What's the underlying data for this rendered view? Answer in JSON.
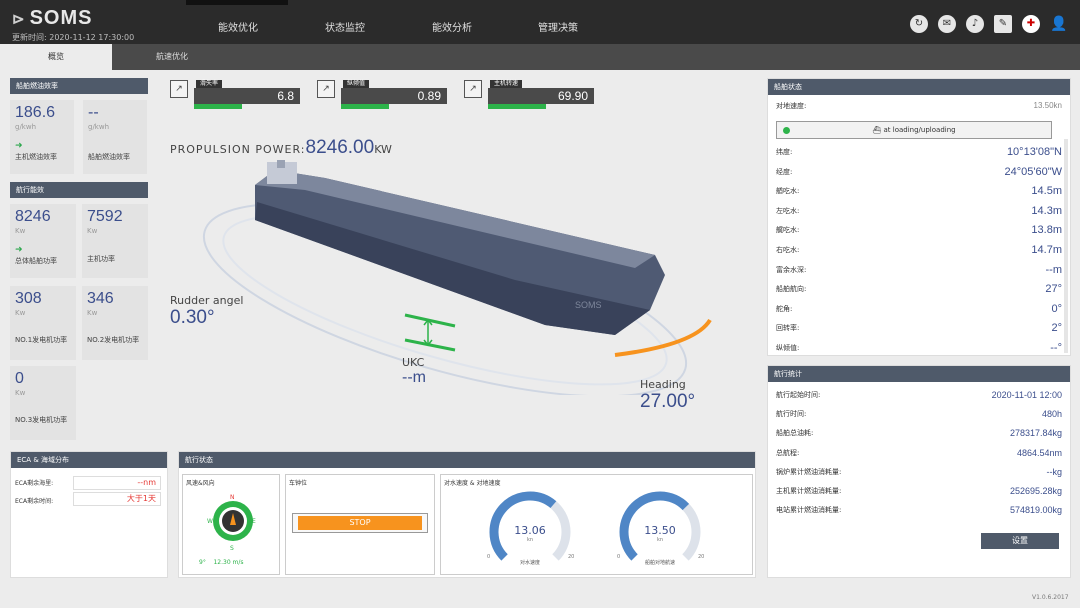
{
  "header": {
    "logo": "SOMS",
    "update_label": "更新时间:",
    "update_time": "2020-11-12 17:30:00",
    "nav": [
      "能效优化",
      "状态监控",
      "能效分析",
      "管理决策"
    ]
  },
  "tabs": [
    "概览",
    "航速优化"
  ],
  "fuel_panel": {
    "title": "船舶燃油效率",
    "cards": [
      {
        "value": "186.6",
        "unit": "g/kwh",
        "label": "主机燃油效率"
      },
      {
        "value": "--",
        "unit": "g/kwh",
        "label": "船舶燃油效率"
      }
    ]
  },
  "nav_panel": {
    "title": "航行能效",
    "cards": [
      {
        "value": "8246",
        "unit": "Kw",
        "label": "总体船舶功率"
      },
      {
        "value": "7592",
        "unit": "Kw",
        "label": "主机功率"
      },
      {
        "value": "308",
        "unit": "Kw",
        "label": "NO.1发电机功率"
      },
      {
        "value": "346",
        "unit": "Kw",
        "label": "NO.2发电机功率"
      },
      {
        "value": "0",
        "unit": "Kw",
        "label": "NO.3发电机功率"
      }
    ]
  },
  "indicators": [
    {
      "label": "滑失率",
      "value": "6.8",
      "fill": 0.45
    },
    {
      "label": "纵倾值",
      "value": "0.89",
      "fill": 0.45
    },
    {
      "label": "主机转速",
      "value": "69.90",
      "fill": 0.55
    }
  ],
  "propulsion": {
    "label": "PROPULSION POWER:",
    "value": "8246.00",
    "unit": "KW"
  },
  "rudder": {
    "label": "Rudder angel",
    "value": "0.30°"
  },
  "ukc": {
    "label": "UKC",
    "value": "--m"
  },
  "heading": {
    "label": "Heading",
    "value": "27.00°"
  },
  "ship_name": "SOMS",
  "ship_status": {
    "title": "船舶状态",
    "speed_label": "对地速度:",
    "speed_value": "13.50kn",
    "status_text": "at loading/uploading",
    "rows": [
      {
        "k": "纬度:",
        "v": "10°13'08\"N"
      },
      {
        "k": "经度:",
        "v": "24°05'60\"W"
      },
      {
        "k": "艏吃水:",
        "v": "14.5m"
      },
      {
        "k": "左吃水:",
        "v": "14.3m"
      },
      {
        "k": "艉吃水:",
        "v": "13.8m"
      },
      {
        "k": "右吃水:",
        "v": "14.7m"
      },
      {
        "k": "富余水深:",
        "v": "--m"
      },
      {
        "k": "船舶航向:",
        "v": "27°"
      },
      {
        "k": "舵角:",
        "v": "0°"
      },
      {
        "k": "回转率:",
        "v": "2°"
      },
      {
        "k": "纵倾值:",
        "v": "--°"
      }
    ]
  },
  "voyage": {
    "title": "航行统计",
    "rows": [
      {
        "k": "航行起始时间:",
        "v": "2020-11-01 12:00"
      },
      {
        "k": "航行时间:",
        "v": "480h"
      },
      {
        "k": "船舶总油耗:",
        "v": "278317.84kg"
      },
      {
        "k": "总航程:",
        "v": "4864.54nm"
      },
      {
        "k": "锅炉累计燃油消耗量:",
        "v": "--kg"
      },
      {
        "k": "主机累计燃油消耗量:",
        "v": "252695.28kg"
      },
      {
        "k": "电站累计燃油消耗量:",
        "v": "574819.00kg"
      }
    ],
    "button": "设置"
  },
  "eca": {
    "title": "ECA & 海域分布",
    "rows": [
      {
        "k": "ECA剩余海里:",
        "v": "--nm"
      },
      {
        "k": "ECA剩余时间:",
        "v": "大于1天"
      }
    ]
  },
  "sail": {
    "title": "航行状态",
    "wind_title": "风速&风向",
    "wind_deg": "9°",
    "wind_speed": "12.30 m/s",
    "compass": {
      "n": "N",
      "s": "S",
      "e": "E",
      "w": "W"
    },
    "telegraph_title": "车钟位",
    "telegraph_value": "STOP",
    "speed_title": "对水速度 & 对地速度",
    "gauges": [
      {
        "value": "13.06",
        "unit": "kn",
        "label": "对水速度",
        "min": "0",
        "max": "20",
        "fraction": 0.65
      },
      {
        "value": "13.50",
        "unit": "kn",
        "label": "船舶对地航速",
        "min": "0",
        "max": "20",
        "fraction": 0.67
      }
    ]
  },
  "version": "V1.0.6.2017",
  "colors": {
    "accent": "#3b4e8c",
    "green": "#2db34a",
    "orange": "#f7931e",
    "header": "#2b2b2b"
  }
}
